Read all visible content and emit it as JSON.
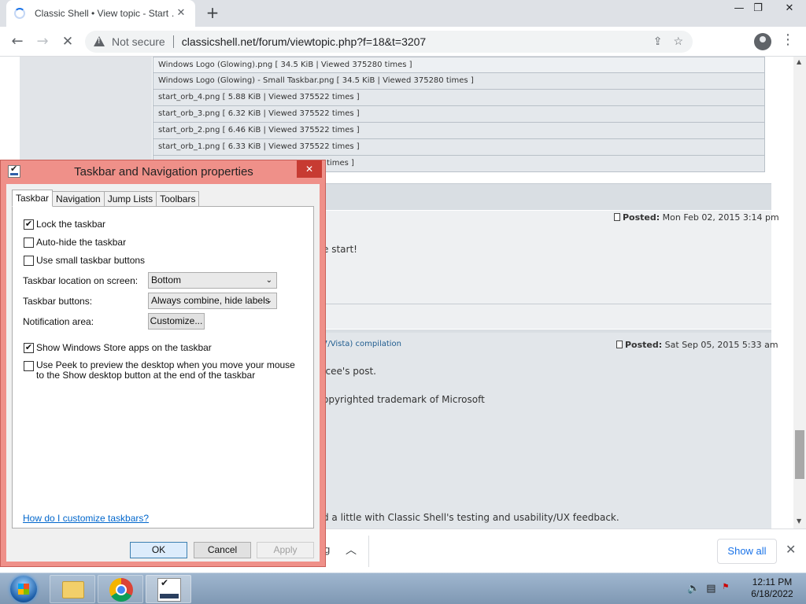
{
  "browser": {
    "tab_title": "Classic Shell • View topic - Start …",
    "new_tab": "+",
    "not_secure": "Not secure",
    "url": "classicshell.net/forum/viewtopic.php?f=18&t=3207"
  },
  "attachments": [
    "Windows Logo (Glowing).png [ 34.5 KiB | Viewed 375280 times ]",
    "Windows Logo (Glowing) - Small Taskbar.png [ 34.5 KiB | Viewed 375280 times ]",
    "start_orb_4.png [ 5.88 KiB | Viewed 375522 times ]",
    "start_orb_3.png [ 6.32 KiB | Viewed 375522 times ]",
    "start_orb_2.png [ 6.46 KiB | Viewed 375522 times ]",
    "start_orb_1.png [ 6.33 KiB | Viewed 375522 times ]",
    "times ]"
  ],
  "post1": {
    "posted_label": "Posted:",
    "posted_date": "Mon Feb 02, 2015 3:14 pm",
    "text": "e start!"
  },
  "post2": {
    "title_fragment": "7/Vista) compilation",
    "posted_label": "Posted:",
    "posted_date": "Sat Sep 05, 2015 5:33 am",
    "text1": "Jcee's post.",
    "text2": "opyrighted trademark of Microsoft",
    "text3": "d a little with Classic Shell's testing and usability/UX feedback."
  },
  "download_bar": {
    "item_tail": "g",
    "show_all": "Show all"
  },
  "dialog": {
    "title": "Taskbar and Navigation properties",
    "close": "✕",
    "tabs": [
      "Taskbar",
      "Navigation",
      "Jump Lists",
      "Toolbars"
    ],
    "checkboxes": {
      "lock": {
        "label": "Lock the taskbar",
        "checked": true
      },
      "autohide": {
        "label": "Auto-hide the taskbar",
        "checked": false
      },
      "small": {
        "label": "Use small taskbar buttons",
        "checked": false
      },
      "store": {
        "label": "Show Windows Store apps on the taskbar",
        "checked": true
      },
      "peek": {
        "label": "Use Peek to preview the desktop when you move your mouse to the Show desktop button at the end of the taskbar",
        "checked": false
      }
    },
    "location_label": "Taskbar location on screen:",
    "location_value": "Bottom",
    "buttons_label": "Taskbar buttons:",
    "buttons_value": "Always combine, hide labels",
    "notification_label": "Notification area:",
    "customize": "Customize...",
    "help_link": "How do I customize taskbars?",
    "ok": "OK",
    "cancel": "Cancel",
    "apply": "Apply"
  },
  "taskbar": {
    "time": "12:11 PM",
    "date": "6/18/2022"
  },
  "icons": {
    "check": "✔",
    "dropdown": "⌄"
  }
}
